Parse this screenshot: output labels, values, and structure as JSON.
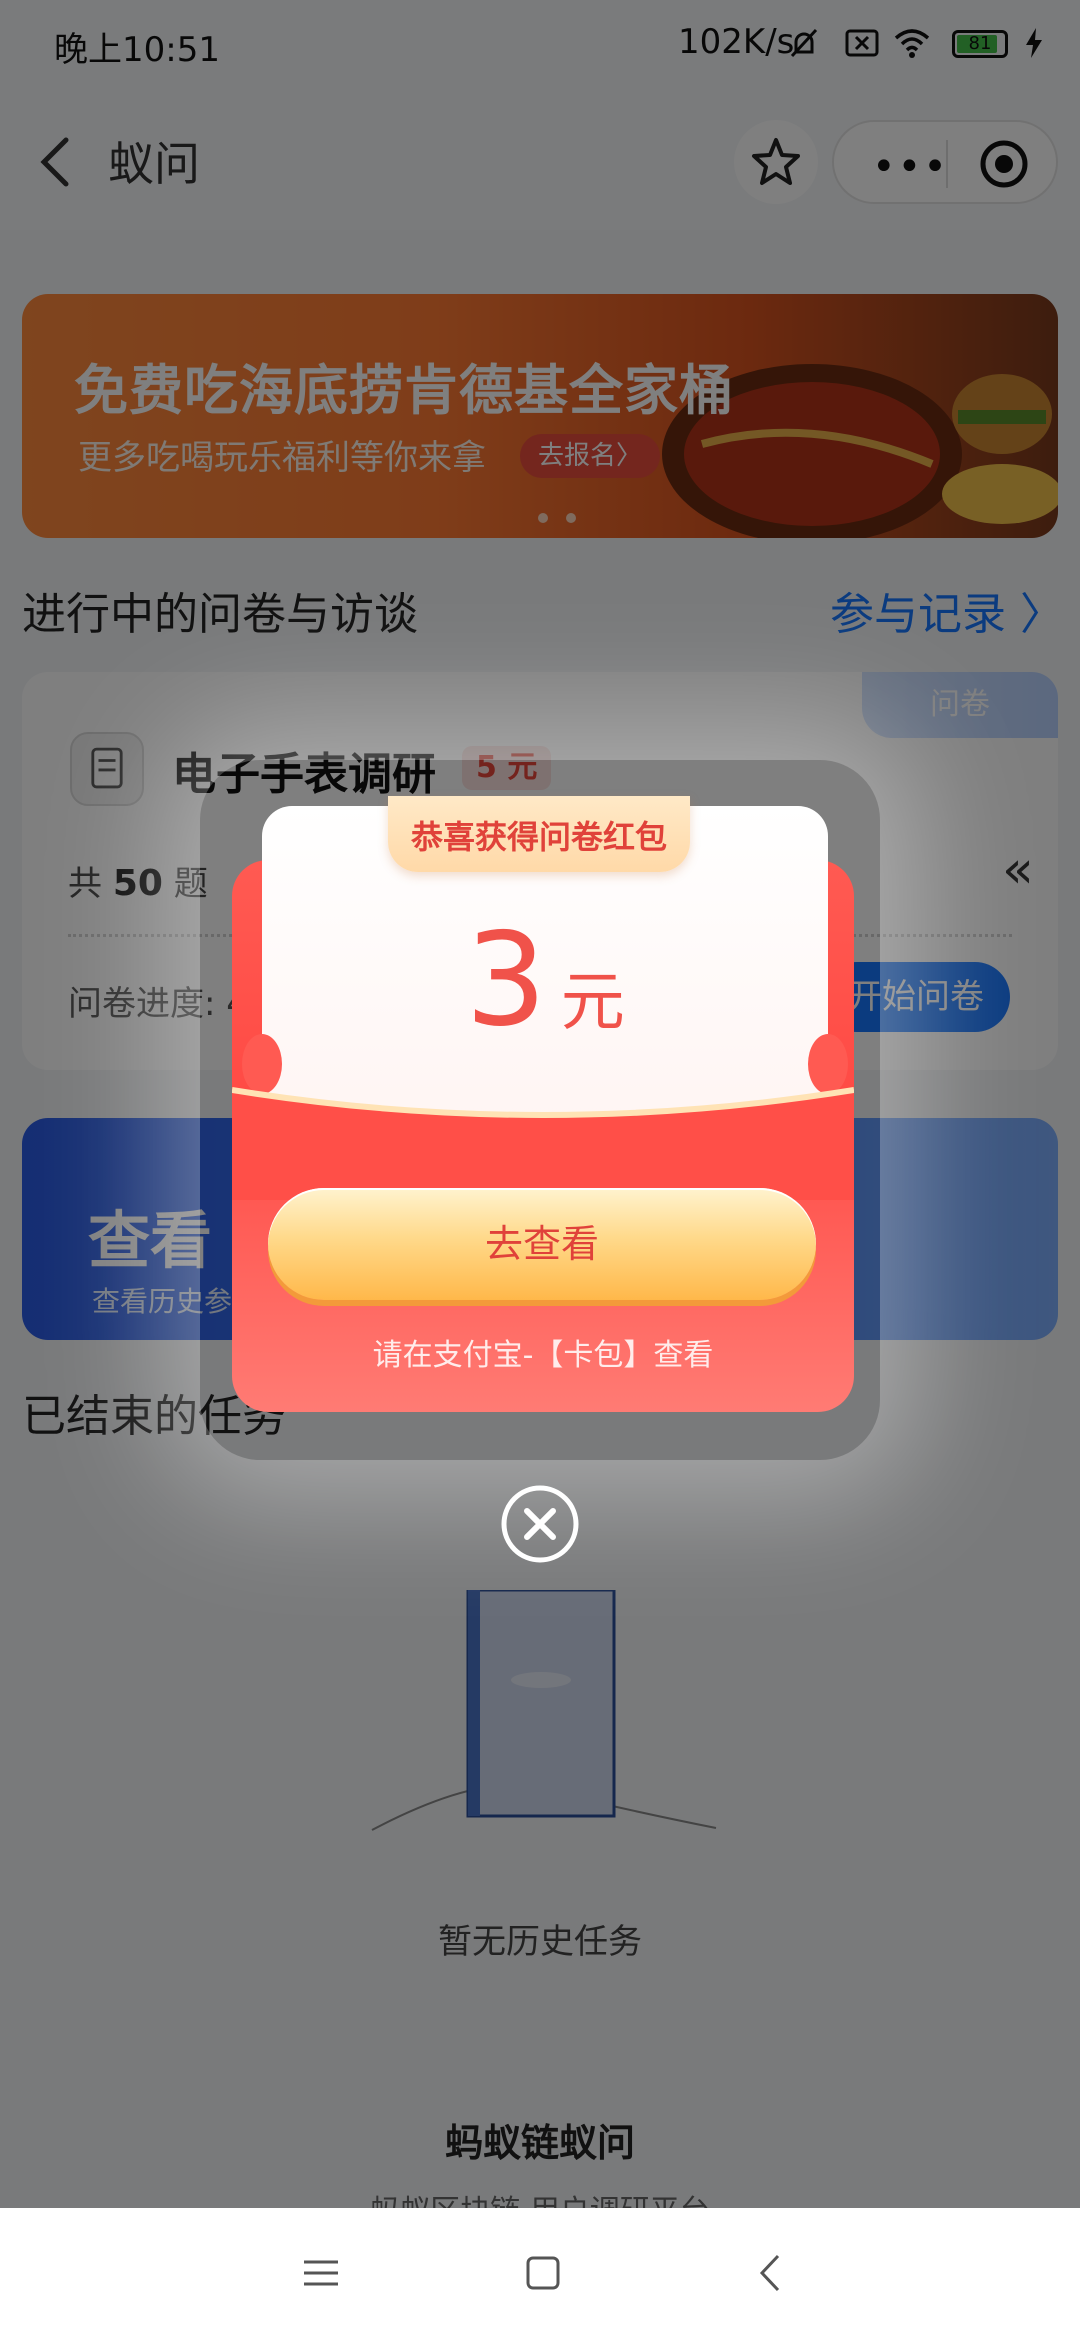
{
  "status_bar": {
    "time": "晚上10:51",
    "net_speed": "102K/s",
    "battery": "81"
  },
  "nav": {
    "title": "蚁问"
  },
  "banner": {
    "title": "免费吃海底捞肯德基全家桶",
    "subtitle": "更多吃喝玩乐福利等你来拿",
    "cta": "去报名〉"
  },
  "ongoing": {
    "title": "进行中的问卷与访谈",
    "link": "参与记录 〉"
  },
  "survey_card": {
    "tag": "问卷",
    "name": "电子手表调研",
    "reward": "5 元",
    "count_prefix": "共",
    "count": "50",
    "count_suffix": "题",
    "progress_label": "问卷进度: 4",
    "start_button": "开始问卷"
  },
  "history_card": {
    "title": "查看",
    "subtitle": "查看历史参"
  },
  "ended": {
    "title": "已结束的任务"
  },
  "empty_state": {
    "text": "暂无历史任务"
  },
  "footer": {
    "title": "蚂蚁链蚁问",
    "subtitle": "蚂蚁区块链·用户调研平台"
  },
  "modal": {
    "ribbon": "恭喜获得问卷红包",
    "amount": "3",
    "unit": "元",
    "button": "去查看",
    "hint": "请在支付宝-【卡包】查看"
  },
  "colors": {
    "accent": "#1677ff",
    "red_packet": "#ff4a44",
    "gold_button": "#ffd98a"
  }
}
